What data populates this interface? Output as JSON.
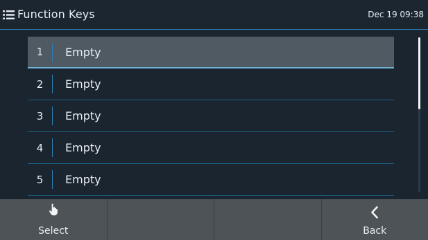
{
  "header": {
    "title": "Function Keys",
    "datetime": "Dec 19 09:38",
    "menu_icon": "list-menu-icon"
  },
  "function_keys": [
    {
      "number": "1",
      "label": "Empty",
      "selected": true
    },
    {
      "number": "2",
      "label": "Empty",
      "selected": false
    },
    {
      "number": "3",
      "label": "Empty",
      "selected": false
    },
    {
      "number": "4",
      "label": "Empty",
      "selected": false
    },
    {
      "number": "5",
      "label": "Empty",
      "selected": false
    }
  ],
  "scrollbar": {
    "position_fraction": 0.0
  },
  "softkeys": [
    {
      "label": "Select",
      "icon": "hand-pointer-icon"
    },
    {
      "label": "",
      "icon": ""
    },
    {
      "label": "",
      "icon": ""
    },
    {
      "label": "Back",
      "icon": "chevron-left-icon"
    }
  ],
  "colors": {
    "background": "#1b2530",
    "accent": "#2f7db6",
    "selected_row": "#4f5a62",
    "softkey_bar": "#4e5358"
  }
}
